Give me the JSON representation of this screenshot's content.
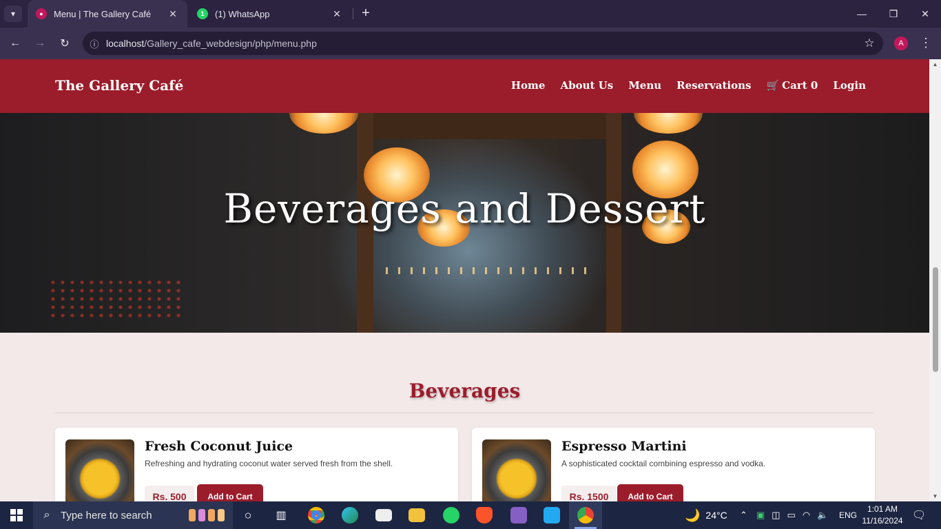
{
  "browser": {
    "tabs": [
      {
        "title": "Menu | The Gallery Café",
        "active": true,
        "favicon": "cafe-favicon"
      },
      {
        "title": "(1) WhatsApp",
        "active": false,
        "favicon": "whatsapp-favicon",
        "badge": "1"
      }
    ],
    "url_host": "localhost",
    "url_path": "/Gallery_cafe_webdesign/php/menu.php",
    "profile_initial": "A"
  },
  "site": {
    "brand": "The Gallery Café",
    "nav": {
      "home": "Home",
      "about": "About Us",
      "menu": "Menu",
      "reservations": "Reservations",
      "cart_label": "Cart",
      "cart_count": "0",
      "login": "Login"
    },
    "hero_title": "Beverages and Dessert",
    "section_title": "Beverages",
    "items": [
      {
        "name": "Fresh Coconut Juice",
        "description": "Refreshing and hydrating coconut water served fresh from the shell.",
        "price": "Rs. 500",
        "button": "Add to Cart"
      },
      {
        "name": "Espresso Martini",
        "description": "A sophisticated cocktail combining espresso and vodka.",
        "price": "Rs. 1500",
        "button": "Add to Cart"
      }
    ]
  },
  "colors": {
    "brand": "#9b1c2b",
    "page_bg": "#f3e9e9"
  },
  "taskbar": {
    "search_placeholder": "Type here to search",
    "weather": "24°C",
    "language": "ENG",
    "time": "1:01 AM",
    "date": "11/16/2024"
  }
}
